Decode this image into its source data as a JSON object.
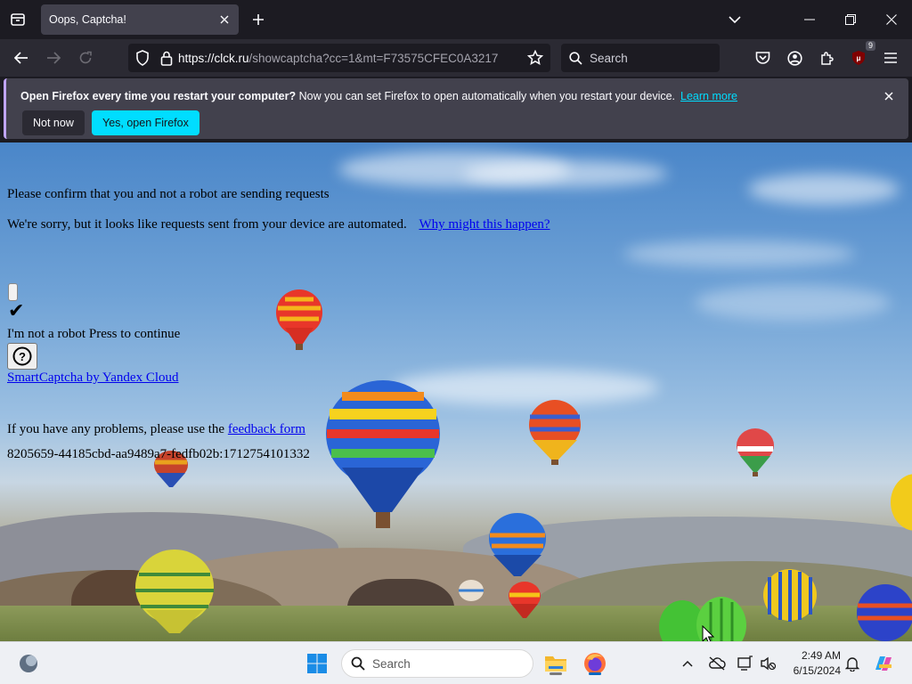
{
  "browser": {
    "tab_title": "Oops, Captcha!",
    "url_host": "https://clck.ru",
    "url_path": "/showcaptcha?cc=1&mt=F73575CFEC0A3217",
    "search_placeholder": "Search",
    "extension_badge": "9"
  },
  "infobar": {
    "bold_text": "Open Firefox every time you restart your computer?",
    "text": " Now you can set Firefox to open automatically when you restart your device.",
    "link": "Learn more",
    "not_now": "Not now",
    "yes_open": "Yes, open Firefox"
  },
  "page": {
    "heading": "Please confirm that you and not a robot are sending requests",
    "sorry": "We're sorry, but it looks like requests sent from your device are automated.",
    "why_link": "Why might this happen?",
    "checkmark": "✔",
    "robot_label": "I'm not a robot Press to continue",
    "help_glyph": "?",
    "smartcaptcha_link": "SmartCaptcha by Yandex Cloud",
    "problems_text": "If you have any problems, please use the ",
    "feedback_link": "feedback form",
    "request_id": "8205659-44185cbd-aa9489a7-fedfb02b:1712754101332"
  },
  "taskbar": {
    "search_placeholder": "Search",
    "time": "2:49 AM",
    "date": "6/15/2024"
  },
  "colors": {
    "accent_cyan": "#00ddff",
    "link_blue": "#0000ee",
    "windows_blue": "#0067c0"
  }
}
